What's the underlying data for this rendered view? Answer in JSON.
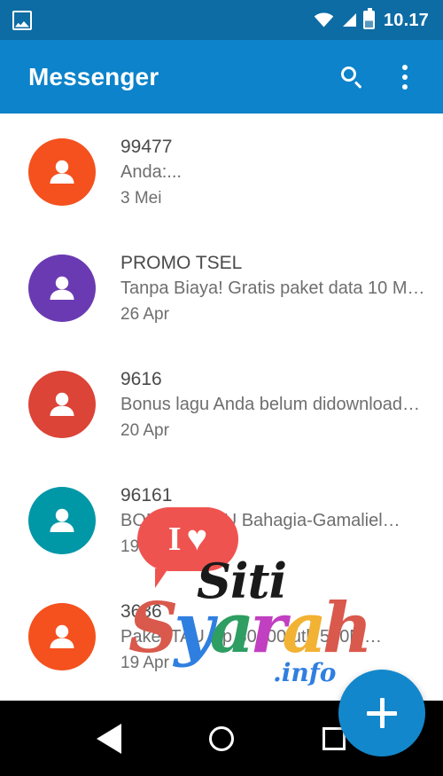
{
  "status_bar": {
    "notification_icon": "photo-icon",
    "wifi_icon": "wifi-icon",
    "signal_icon": "signal-icon",
    "battery_icon": "battery-icon",
    "time": "10.17",
    "background": "#0d6ca4"
  },
  "app_bar": {
    "title": "Messenger",
    "search_icon": "search-icon",
    "overflow_icon": "overflow-menu-icon",
    "background": "#0c83ca"
  },
  "conversations": [
    {
      "name": "99477",
      "snippet": "Anda:...",
      "date": "3 Mei",
      "avatar_color": "#F4511E"
    },
    {
      "name": "PROMO TSEL",
      "snippet": "Tanpa Biaya! Gratis paket data 10 M…",
      "date": "26 Apr",
      "avatar_color": "#6A3AB2"
    },
    {
      "name": "9616",
      "snippet": "Bonus lagu Anda belum didownload…",
      "date": "20 Apr",
      "avatar_color": "#DB4437"
    },
    {
      "name": "96161",
      "snippet": "BONUS LAGU Bahagia-Gamaliel…",
      "date": "19 Apr",
      "avatar_color": "#0097A7"
    },
    {
      "name": "3636",
      "snippet": "Paket TAU Rp 30000 utk 500M…",
      "date": "19 Apr",
      "avatar_color": "#F4511E"
    }
  ],
  "fab": {
    "icon": "plus-icon",
    "color": "#1387CC"
  },
  "watermark": {
    "bubble_i": "I",
    "bubble_heart": "♥",
    "siti": "Siti",
    "syarah_letters": [
      {
        "char": "S",
        "color": "#D9594C"
      },
      {
        "char": "y",
        "color": "#2F7FE0"
      },
      {
        "char": "a",
        "color": "#2E9E63"
      },
      {
        "char": "r",
        "color": "#C13FC1"
      },
      {
        "char": "a",
        "color": "#F2B233"
      },
      {
        "char": "h",
        "color": "#D9594C"
      }
    ],
    "info": ".info",
    "bubble_color": "#EF5350"
  },
  "nav_bar": {
    "back_icon": "back-triangle-icon",
    "home_icon": "home-circle-icon",
    "recents_icon": "recents-square-icon"
  }
}
